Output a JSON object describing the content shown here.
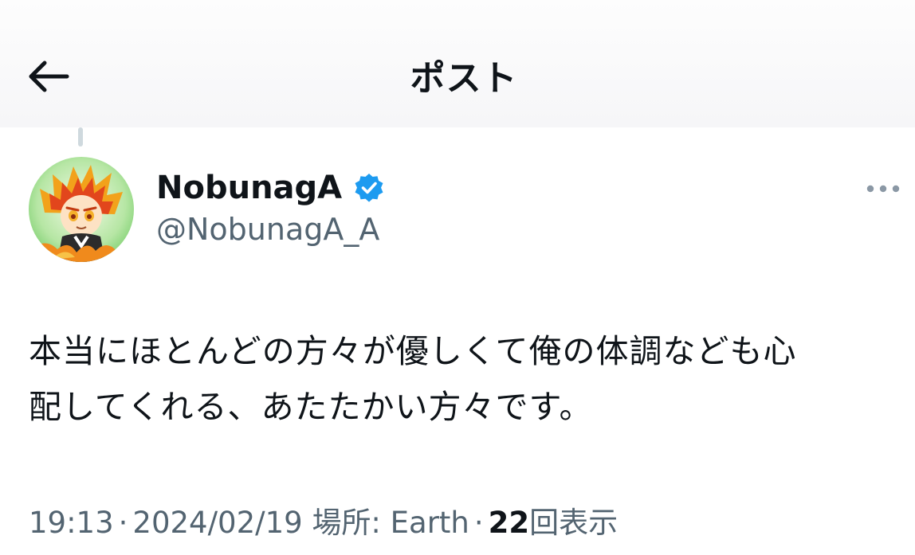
{
  "header": {
    "title": "ポスト",
    "back_icon": "arrow-left-icon"
  },
  "author": {
    "display_name": "NobunagA",
    "handle": "@NobunagA_A",
    "verified_icon": "verified-badge-icon",
    "verified_color": "#1d9bf0",
    "avatar_icon": "avatar"
  },
  "more_icon": "more-horizontal-icon",
  "post": {
    "text": "本当にほとんどの方々が優しくて俺の体調なども心\n配してくれる、あたたかい方々です。"
  },
  "meta": {
    "time": "19:13",
    "separator": "·",
    "date": "2024/02/19",
    "location": "場所: Earth",
    "views_count": "22",
    "views_label": "回表示"
  },
  "colors": {
    "text_primary": "#0f1419",
    "text_secondary": "#536471",
    "accent": "#1d9bf0",
    "thread_line": "#cfd9de"
  }
}
